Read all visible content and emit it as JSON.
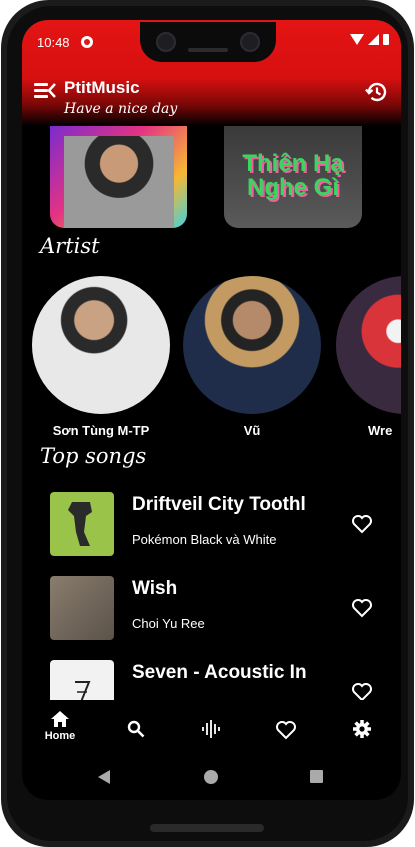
{
  "status": {
    "time": "10:48"
  },
  "header": {
    "title": "PtitMusic",
    "subtitle": "Have a nice day"
  },
  "albums": [
    {
      "name": "album-1",
      "text": ""
    },
    {
      "name": "album-2",
      "text": "Thiên Hạ Nghe Gì"
    }
  ],
  "sections": {
    "artist": "Artist",
    "top_songs": "Top songs"
  },
  "artists": [
    {
      "name": "Sơn Tùng M-TP"
    },
    {
      "name": "Vũ"
    },
    {
      "name": "Wre"
    }
  ],
  "songs": [
    {
      "title": "Driftveil City Toothl",
      "subtitle": "Pokémon Black và White",
      "art_color": "#9ac34a"
    },
    {
      "title": "Wish",
      "subtitle": "Choi Yu Ree",
      "art_color": "#6e6358"
    },
    {
      "title": "Seven - Acoustic In",
      "subtitle": "",
      "art_color": "#f2f2f2"
    }
  ],
  "nav": {
    "home": "Home"
  },
  "colors": {
    "accent": "#e41414",
    "background": "#000000"
  }
}
